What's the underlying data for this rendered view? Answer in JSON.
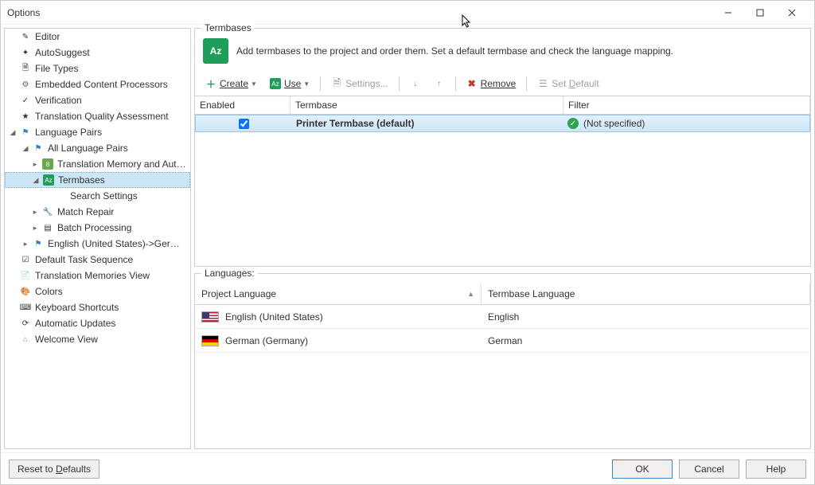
{
  "window": {
    "title": "Options"
  },
  "sidebar": {
    "items": [
      {
        "label": "Editor",
        "icon": "editor"
      },
      {
        "label": "AutoSuggest",
        "icon": "autosuggest"
      },
      {
        "label": "File Types",
        "icon": "filetypes"
      },
      {
        "label": "Embedded Content Processors",
        "icon": "embedded"
      },
      {
        "label": "Verification",
        "icon": "verification"
      },
      {
        "label": "Translation Quality Assessment",
        "icon": "tqa"
      },
      {
        "label": "Language Pairs",
        "icon": "langpairs",
        "expanded": true,
        "children": [
          {
            "label": "All Language Pairs",
            "icon": "flag",
            "expanded": true,
            "children": [
              {
                "label": "Translation Memory and Autom",
                "icon": "tm",
                "expandable": true
              },
              {
                "label": "Termbases",
                "icon": "tb",
                "selected": true,
                "expanded": true,
                "children": [
                  {
                    "label": "Search Settings",
                    "icon": "none"
                  }
                ]
              },
              {
                "label": "Match Repair",
                "icon": "wrench",
                "expandable": true
              },
              {
                "label": "Batch Processing",
                "icon": "batch",
                "expandable": true
              }
            ]
          },
          {
            "label": "English (United States)->German (G",
            "icon": "flag",
            "expandable": true
          }
        ]
      },
      {
        "label": "Default Task Sequence",
        "icon": "task"
      },
      {
        "label": "Translation Memories View",
        "icon": "tmview"
      },
      {
        "label": "Colors",
        "icon": "colors"
      },
      {
        "label": "Keyboard Shortcuts",
        "icon": "keyboard"
      },
      {
        "label": "Automatic Updates",
        "icon": "updates"
      },
      {
        "label": "Welcome View",
        "icon": "home"
      }
    ]
  },
  "main": {
    "termbases_title": "Termbases",
    "description": "Add termbases to the project and order them. Set a default termbase and check the language mapping.",
    "toolbar": {
      "create": "Create",
      "use": "Use",
      "settings": "Settings...",
      "remove": "Remove",
      "set_default": "Set Default"
    },
    "columns": {
      "enabled": "Enabled",
      "termbase": "Termbase",
      "filter": "Filter"
    },
    "rows": [
      {
        "enabled": true,
        "name": "Printer Termbase (default)",
        "filter": "(Not specified)"
      }
    ],
    "languages_title": "Languages:",
    "lang_columns": {
      "project": "Project Language",
      "termbase": "Termbase Language"
    },
    "languages": [
      {
        "flag": "us",
        "project": "English (United States)",
        "termbase": "English"
      },
      {
        "flag": "de",
        "project": "German (Germany)",
        "termbase": "German"
      }
    ]
  },
  "footer": {
    "reset": "Reset to Defaults",
    "ok": "OK",
    "cancel": "Cancel",
    "help": "Help"
  }
}
